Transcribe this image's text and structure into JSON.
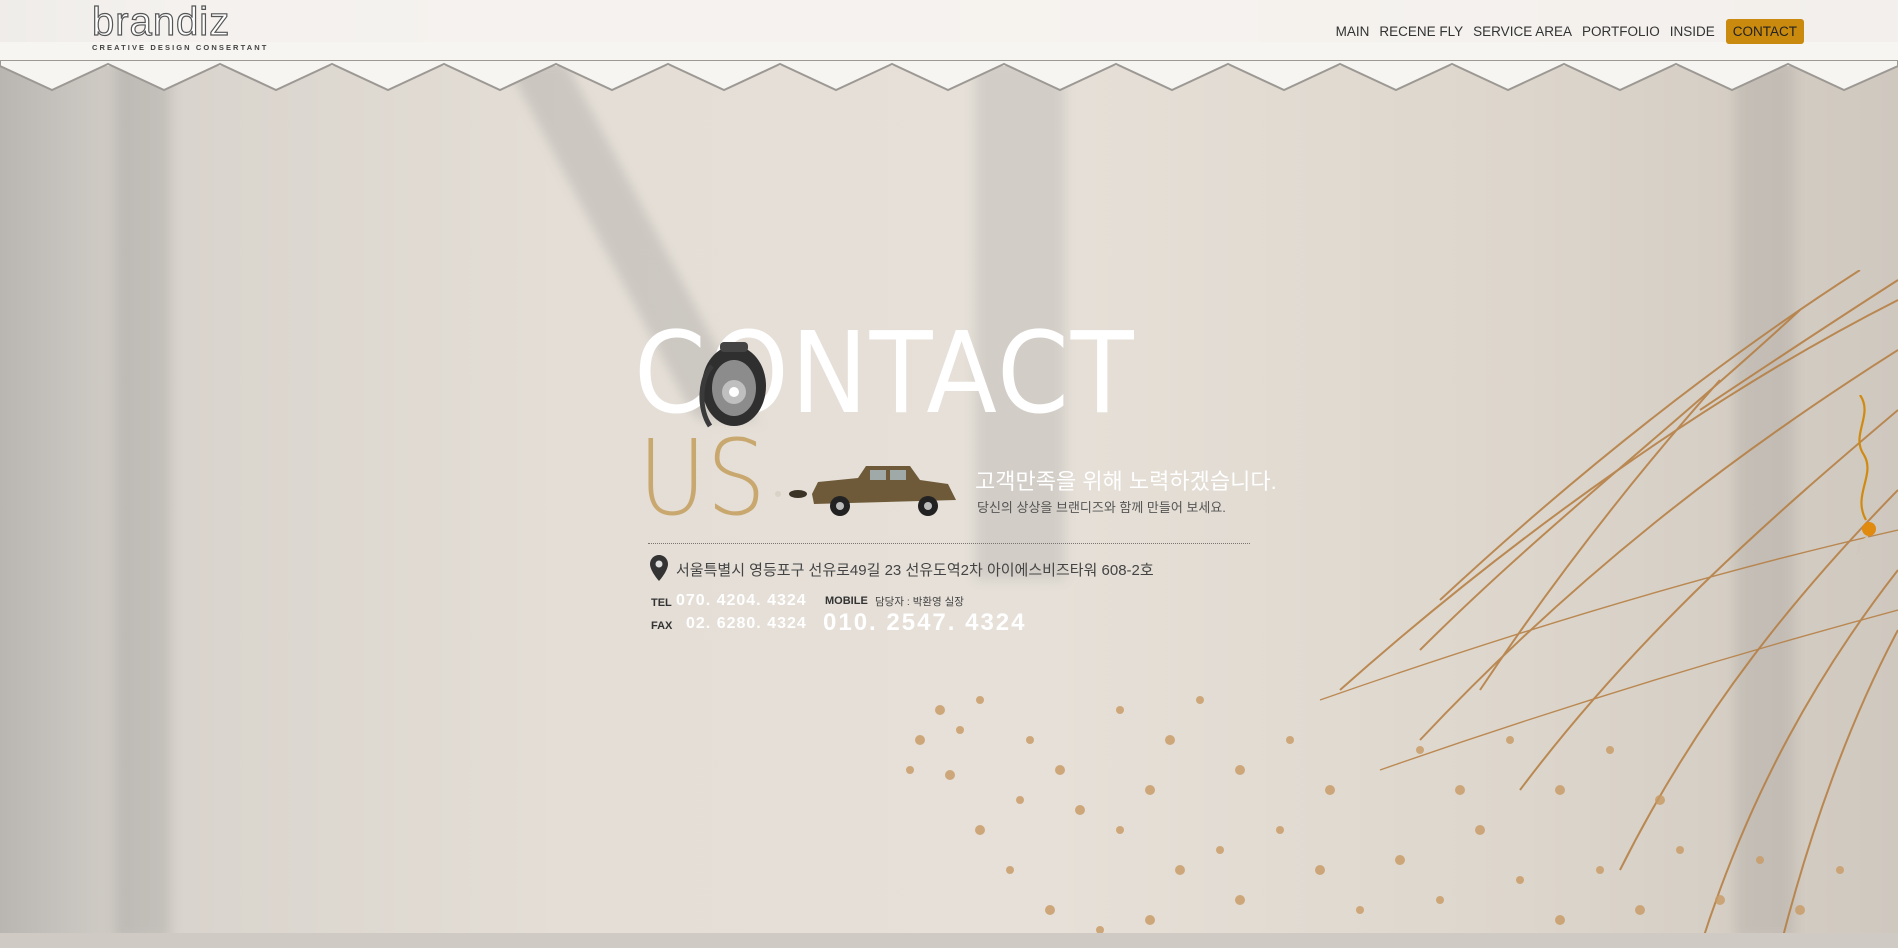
{
  "logo": {
    "wordmark": "brandiz",
    "tagline": "CREATIVE DESIGN CONSERTANT"
  },
  "nav": {
    "items": [
      "MAIN",
      "RECENE FLY",
      "SERVICE AREA",
      "PORTFOLIO",
      "INSIDE"
    ],
    "active": "CONTACT"
  },
  "hero": {
    "title_contact": "CONTACT",
    "title_us": "US",
    "tagline": "고객만족을 위해 노력하겠습니다.",
    "subtagline": "당신의 상상을 브랜디즈와 함께 만들어 보세요."
  },
  "contact": {
    "address": "서울특별시 영등포구 선유로49길 23 선유도역2차 아이에스비즈타워 608-2호",
    "tel_label": "TEL",
    "tel": "070. 4204. 4324",
    "fax_label": "FAX",
    "fax": "02. 6280. 4324",
    "mobile_label": "MOBILE",
    "manager": "담당자 : 박환영 실장",
    "mobile": "010. 2547. 4324"
  },
  "colors": {
    "accent": "#c98a0d",
    "us_gold": "#c9a870",
    "background": "#e4ded6"
  },
  "icons": [
    "telephone-icon",
    "taxi-illustration",
    "location-pin-icon",
    "dried-flower-illustration"
  ]
}
